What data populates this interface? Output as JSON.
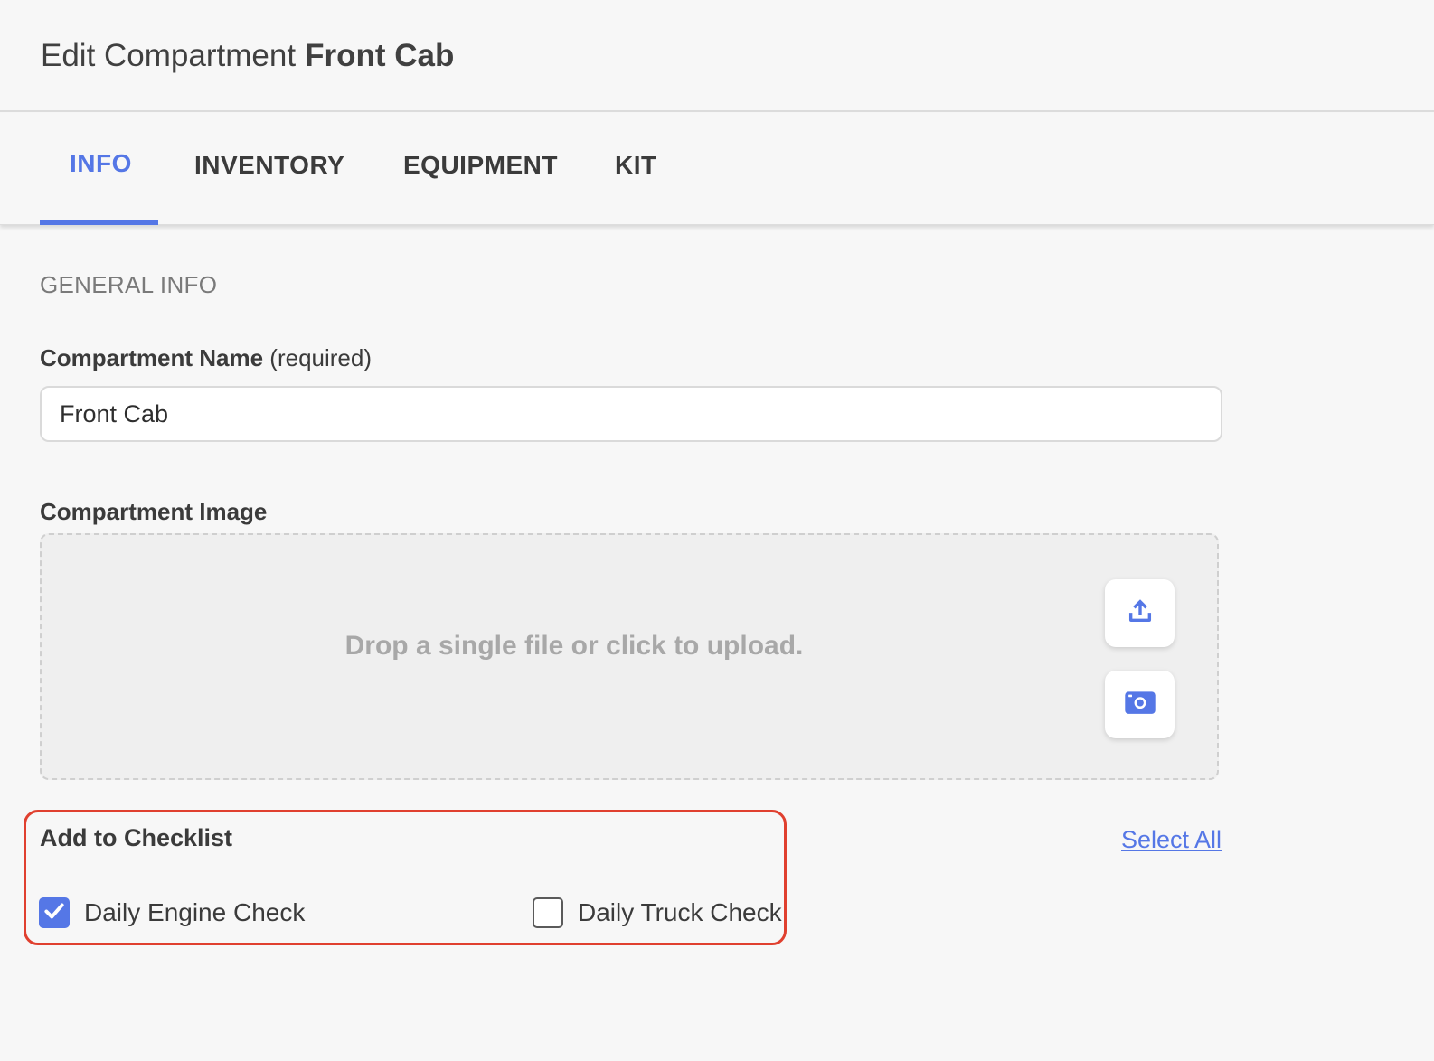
{
  "header": {
    "prefix": "Edit Compartment",
    "compartment_name": "Front Cab"
  },
  "tabs": [
    {
      "label": "INFO",
      "active": true
    },
    {
      "label": "INVENTORY",
      "active": false
    },
    {
      "label": "EQUIPMENT",
      "active": false
    },
    {
      "label": "KIT",
      "active": false
    }
  ],
  "general_info": {
    "section_label": "GENERAL INFO",
    "name_label": "Compartment Name",
    "name_required": "(required)",
    "name_value": "Front Cab",
    "image_label": "Compartment Image",
    "dropzone_text": "Drop a single file or click to upload.",
    "upload_icon": "upload-icon",
    "camera_icon": "camera-icon"
  },
  "checklist": {
    "title": "Add to Checklist",
    "select_all": "Select All",
    "items": [
      {
        "label": "Daily Engine Check",
        "checked": true
      },
      {
        "label": "Daily Truck Check",
        "checked": false
      }
    ]
  },
  "colors": {
    "accent": "#5577e6",
    "highlight_border": "#e0402f"
  }
}
